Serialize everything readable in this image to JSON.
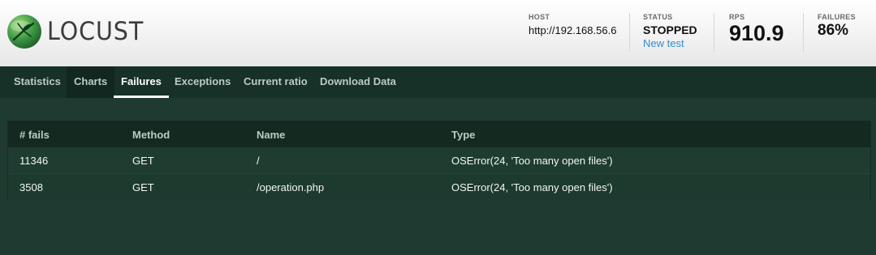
{
  "app": {
    "logo_text": "LOCUST"
  },
  "stats": {
    "host": {
      "label": "HOST",
      "value": "http://192.168.56.6"
    },
    "status": {
      "label": "STATUS",
      "value": "STOPPED",
      "link": "New test"
    },
    "rps": {
      "label": "RPS",
      "value": "910.9"
    },
    "failures": {
      "label": "FAILURES",
      "value": "86%"
    }
  },
  "tabs": [
    {
      "label": "Statistics"
    },
    {
      "label": "Charts"
    },
    {
      "label": "Failures"
    },
    {
      "label": "Exceptions"
    },
    {
      "label": "Current ratio"
    },
    {
      "label": "Download Data"
    }
  ],
  "active_tab": "Failures",
  "table": {
    "headers": [
      "# fails",
      "Method",
      "Name",
      "Type"
    ],
    "rows": [
      [
        "11346",
        "GET",
        "/",
        "OSError(24, 'Too many open files')"
      ],
      [
        "3508",
        "GET",
        "/operation.php",
        "OSError(24, 'Too many open files')"
      ]
    ]
  },
  "colors": {
    "brand_green": "#3f9b46",
    "link_blue": "#2f8fd1",
    "nav_bg": "#173028",
    "page_bg": "#1f3a30"
  },
  "icons": {
    "logo": "locust-logo-icon"
  }
}
